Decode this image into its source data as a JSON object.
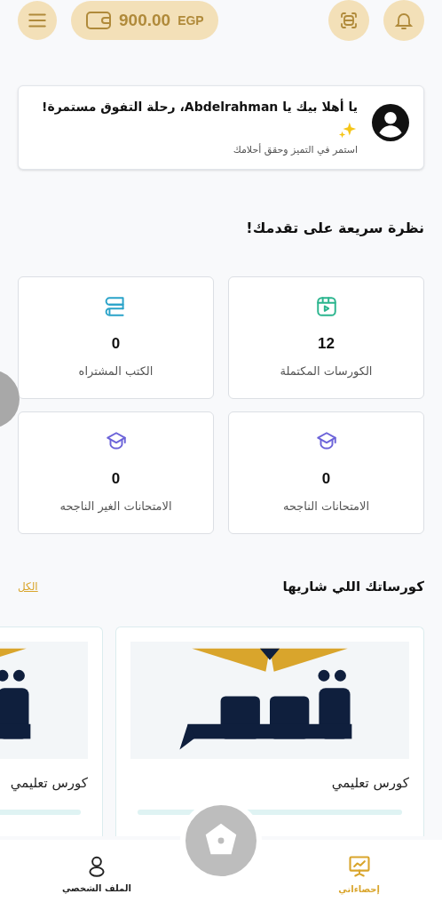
{
  "top_bar": {
    "balance": "900.00",
    "currency": "EGP"
  },
  "greeting": {
    "title": "يا أهلا بيك يا Abdelrahman، رحلة التفوق مستمرة!",
    "subtitle": "استمر في التميز وحقق أحلامك"
  },
  "overview": {
    "title": "نظرة سريعة على تقدمك!",
    "stats": [
      {
        "kind": "video",
        "color": "#2bb58e",
        "value": "12",
        "label": "الكورسات المكتملة"
      },
      {
        "kind": "books",
        "color": "#2aa3c9",
        "value": "0",
        "label": "الكتب المشتراه"
      },
      {
        "kind": "exam",
        "color": "#6c63d9",
        "value": "0",
        "label": "الامتحانات الناجحه"
      },
      {
        "kind": "exam",
        "color": "#6c63d9",
        "value": "0",
        "label": "الامتحانات الغير الناجحه"
      }
    ]
  },
  "courses": {
    "title": "كورساتك اللي شاريها",
    "see_all": "الكل",
    "items": [
      {
        "kind": "picture",
        "title": "كورس تعليمي",
        "level": 0
      },
      {
        "kind": "picture",
        "title": "كورس تعليمي",
        "level": 0
      }
    ]
  },
  "bottom_nav": [
    {
      "kind": "stats",
      "label": "إحصاءاتي",
      "selected": true
    },
    {
      "kind": "profile",
      "label": "الملف الشخصي",
      "selected": false
    }
  ]
}
